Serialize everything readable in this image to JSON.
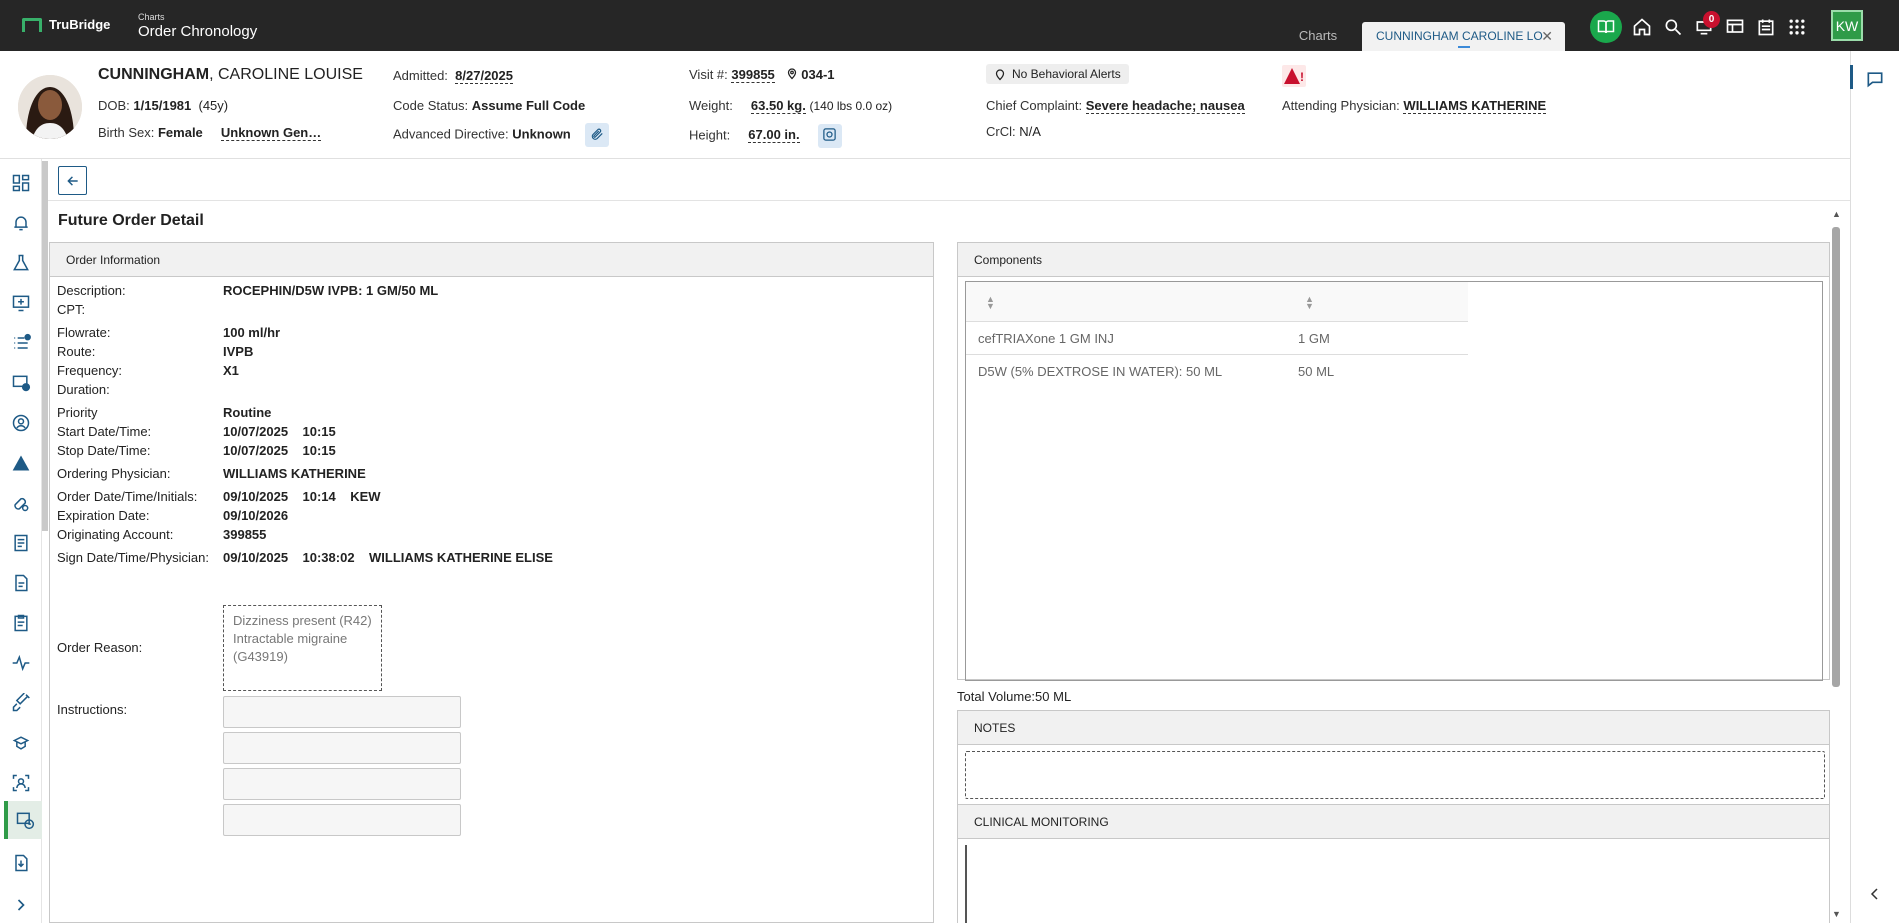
{
  "topbar": {
    "brand": "TruBridge",
    "section": "Charts",
    "title": "Order Chronology",
    "tabs": [
      {
        "label": "Charts"
      },
      {
        "label": "CUNNINGHAM CAROLINE LO"
      }
    ],
    "notification_count": "0",
    "user_initials": "KW",
    "icons": [
      "book-icon",
      "home-icon",
      "search-icon",
      "bell-notify-icon",
      "monitor-icon",
      "calendar-icon",
      "grid-apps-icon"
    ]
  },
  "patient": {
    "last_name": "CUNNINGHAM",
    "first_name": ", CAROLINE LOUISE",
    "dob_label": "DOB:",
    "dob": "1/15/1981",
    "age": "(45y)",
    "birth_sex_label": "Birth Sex:",
    "birth_sex": "Female",
    "gender": "Unknown Gen…",
    "admitted_label": "Admitted:",
    "admitted": "8/27/2025",
    "code_status_label": "Code Status:",
    "code_status": "Assume Full Code",
    "adv_directive_label": "Advanced Directive:",
    "adv_directive": "Unknown",
    "visit_label": "Visit #:",
    "visit": "399855",
    "room": "034-1",
    "weight_label": "Weight:",
    "weight": "63.50 kg.",
    "weight_alt": "(140 lbs 0.0 oz)",
    "height_label": "Height:",
    "height": "67.00 in.",
    "behavioral_alerts": "No Behavioral Alerts",
    "complaint_label": "Chief Complaint:",
    "complaint": "Severe headache; nausea",
    "crcl_label": "CrCl:",
    "crcl": "N/A",
    "attending_label": "Attending Physician:",
    "attending": "WILLIAMS KATHERINE"
  },
  "page": {
    "title": "Future Order Detail"
  },
  "order_info": {
    "header": "Order Information",
    "rows": [
      {
        "label": "Description:",
        "value": "ROCEPHIN/D5W IVPB: 1 GM/50 ML"
      },
      {
        "label": "CPT:",
        "value": ""
      },
      {
        "label": "Flowrate:",
        "value": "100 ml/hr"
      },
      {
        "label": "Route:",
        "value": "IVPB"
      },
      {
        "label": "Frequency:",
        "value": "X1"
      },
      {
        "label": "Duration:",
        "value": ""
      },
      {
        "label": "Priority",
        "value": "Routine"
      },
      {
        "label": "Start Date/Time:",
        "value": "10/07/2025    10:15"
      },
      {
        "label": "Stop Date/Time:",
        "value": "10/07/2025    10:15"
      },
      {
        "label": "Ordering Physician:",
        "value": "WILLIAMS KATHERINE"
      },
      {
        "label": "Order Date/Time/Initials:",
        "value": "09/10/2025    10:14    KEW"
      },
      {
        "label": "Expiration Date:",
        "value": "09/10/2026"
      },
      {
        "label": "Originating Account:",
        "value": "399855"
      },
      {
        "label": "Sign Date/Time/Physician:",
        "value": "09/10/2025    10:38:02    WILLIAMS KATHERINE ELISE"
      }
    ],
    "reason_label": "Order Reason:",
    "reasons": [
      "Dizziness present (R42)",
      "Intractable migraine",
      "(G43919)"
    ],
    "instructions_label": "Instructions:"
  },
  "components": {
    "header": "Components",
    "rows": [
      {
        "name": "cefTRIAXone 1 GM INJ",
        "amount": "1 GM"
      },
      {
        "name": "D5W (5% DEXTROSE IN WATER): 50 ML",
        "amount": "50 ML"
      }
    ],
    "total_label": "Total Volume:",
    "total": "50 ML"
  },
  "notes": {
    "header": "NOTES"
  },
  "monitoring": {
    "header": "CLINICAL MONITORING"
  }
}
